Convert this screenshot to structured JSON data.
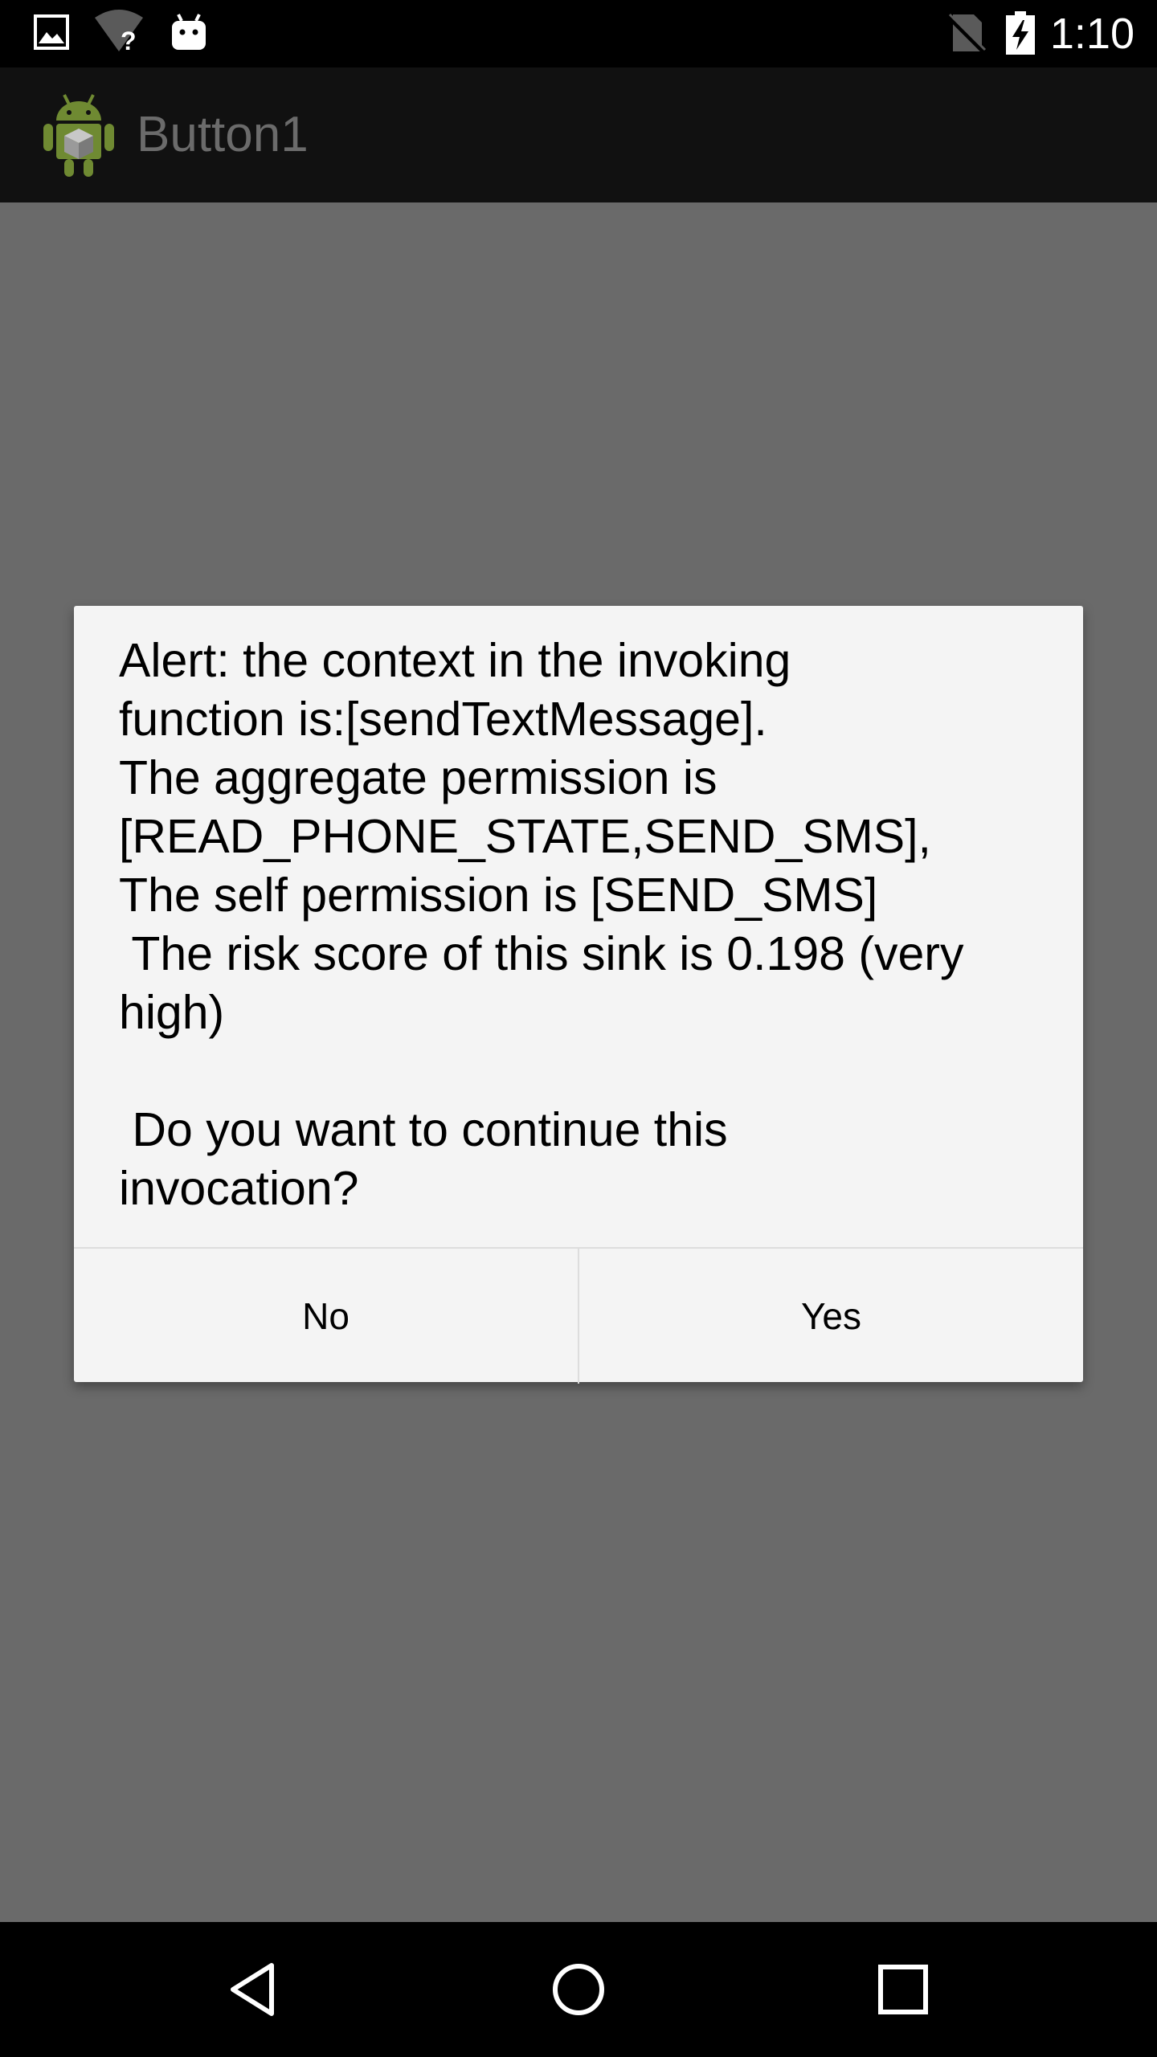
{
  "status_bar": {
    "time": "1:10",
    "icons": [
      "image-icon",
      "wifi-unknown-icon",
      "android-debug-icon",
      "no-sim-icon",
      "battery-charging-icon"
    ]
  },
  "action_bar": {
    "app_icon": "android-app-icon",
    "title": "Button1"
  },
  "dialog": {
    "message": "Alert: the context in the invoking\nfunction is:[sendTextMessage].\nThe aggregate permission is\n[READ_PHONE_STATE,SEND_SMS],\nThe self permission is [SEND_SMS]\n The risk score of this sink is 0.198 (very\nhigh)\n\n Do you want to continue this\ninvocation?",
    "negative_button": "No",
    "positive_button": "Yes"
  },
  "nav_bar": {
    "icons": [
      "back-icon",
      "home-icon",
      "recents-icon"
    ]
  },
  "colors": {
    "status_bar": "#000000",
    "action_bar": "#111111",
    "dim_background": "#6a6a6a",
    "dialog_background": "#f4f4f4",
    "app_icon_green": "#6f8a32"
  }
}
